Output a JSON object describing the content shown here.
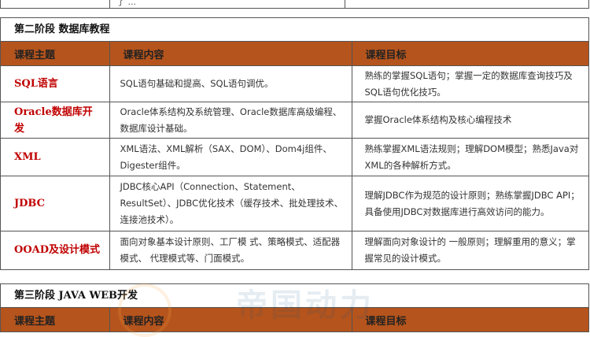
{
  "previous_row": {
    "fragment": "了 ..."
  },
  "stage2": {
    "title": "第二阶段 数据库教程",
    "headers": [
      "课程主题",
      "课程内容",
      "课程目标"
    ],
    "rows": [
      {
        "topic": "SQL语言",
        "content": "SQL语句基础和提高、SQL语句调优。",
        "goal": "熟练的掌握SQL语句；掌握一定的数据库查询技巧及SQL语句优化技巧。"
      },
      {
        "topic": "Oracle数据库开发",
        "content": "Oracle体系结构及系统管理、Oracle数据库高级编程、数据库设计基础。",
        "goal": "掌握Oracle体系结构及核心编程技术"
      },
      {
        "topic": "XML",
        "content": "XML语法、XML解析（SAX、DOM）、Dom4j组件、Digester组件。",
        "goal": "熟练掌握XML语法规则；理解DOM模型；熟悉Java对XML的各种解析方式。"
      },
      {
        "topic": "JDBC",
        "content": "JDBC核心API（Connection、Statement、ResultSet）、JDBC优化技术（缓存技术、批处理技术、连接池技术）。",
        "goal": "理解JDBC作为规范的设计原则；熟练掌握JDBC API；具备使用JDBC对数据库进行高效访问的能力。"
      },
      {
        "topic": "OOAD及设计模式",
        "content": "面向对象基本设计原则、工厂模 式、策略模式、适配器模式、 代理模式等、门面模式。",
        "goal": "理解面向对象设计的 一般原则；理解重用的意义；掌握常见的设计模式。"
      }
    ]
  },
  "stage3": {
    "title": "第三阶段 JAVA WEB开发",
    "headers": [
      "课程主题",
      "课程内容",
      "课程目标"
    ]
  },
  "watermark": {
    "text": "帝国动力"
  }
}
